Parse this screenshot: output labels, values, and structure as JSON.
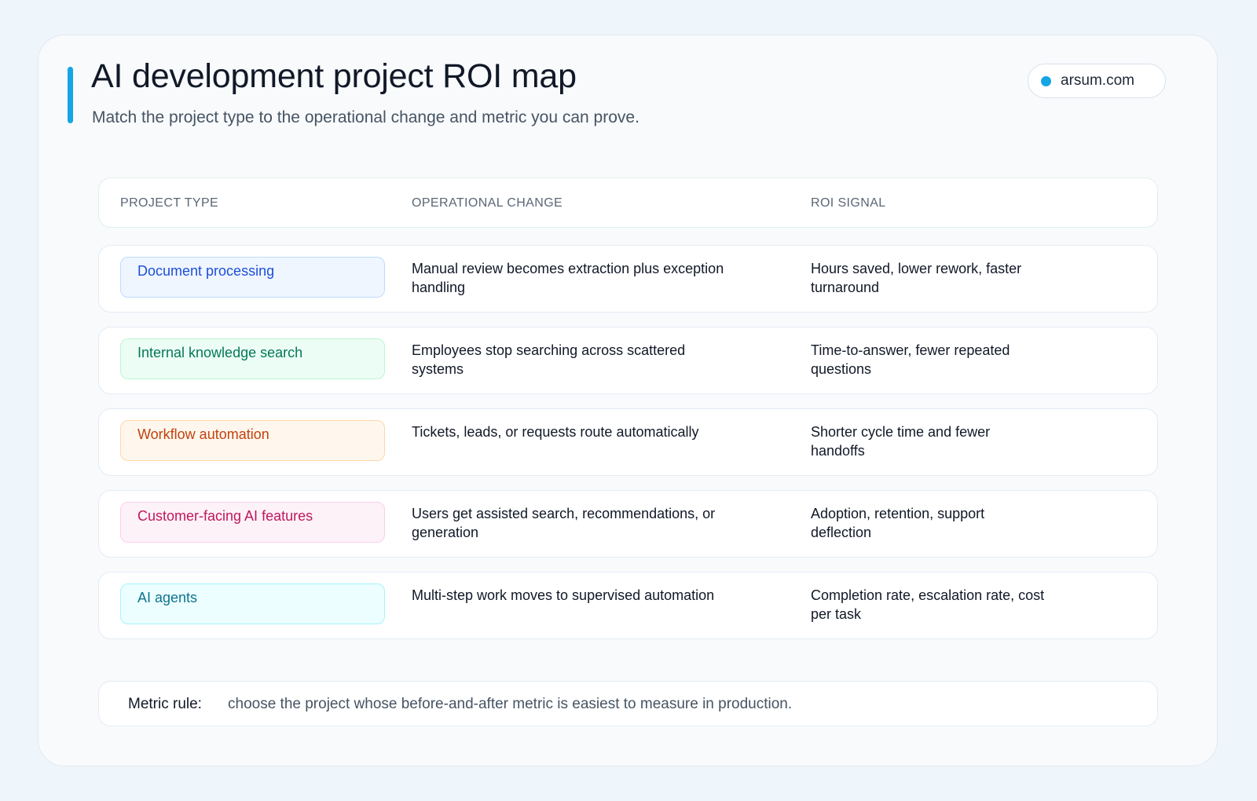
{
  "header": {
    "title": "AI development project ROI map",
    "subtitle": "Match the project type to the operational change and metric you can prove."
  },
  "site_chip": {
    "label": "arsum.com",
    "dot_color": "#15a5e4"
  },
  "table": {
    "columns": [
      "PROJECT TYPE",
      "OPERATIONAL CHANGE",
      "ROI SIGNAL"
    ],
    "rows": [
      {
        "project_type": "Document processing",
        "operational_change": "Manual review becomes extraction plus exception handling",
        "roi_signal": "Hours saved, lower rework, faster turnaround",
        "pill_text": "#1d4ed8",
        "pill_bg": "#eff6ff",
        "pill_border": "#bfdbfe"
      },
      {
        "project_type": "Internal knowledge search",
        "operational_change": "Employees stop searching across scattered systems",
        "roi_signal": "Time-to-answer, fewer repeated questions",
        "pill_text": "#047857",
        "pill_bg": "#ecfdf5",
        "pill_border": "#bbf7d0"
      },
      {
        "project_type": "Workflow automation",
        "operational_change": "Tickets, leads, or requests route automatically",
        "roi_signal": "Shorter cycle time and fewer handoffs",
        "pill_text": "#c2410c",
        "pill_bg": "#fff7ed",
        "pill_border": "#fed7aa"
      },
      {
        "project_type": "Customer-facing AI features",
        "operational_change": "Users get assisted search, recommendations, or generation",
        "roi_signal": "Adoption, retention, support deflection",
        "pill_text": "#be185d",
        "pill_bg": "#fdf2f8",
        "pill_border": "#fbcfe8"
      },
      {
        "project_type": "AI agents",
        "operational_change": "Multi-step work moves to supervised automation",
        "roi_signal": "Completion rate, escalation rate, cost per task",
        "pill_text": "#0e7490",
        "pill_bg": "#ecfeff",
        "pill_border": "#a5f3fc"
      }
    ]
  },
  "footer": {
    "label": "Metric rule:",
    "text": "choose the project whose before-and-after metric is easiest to measure in production."
  }
}
